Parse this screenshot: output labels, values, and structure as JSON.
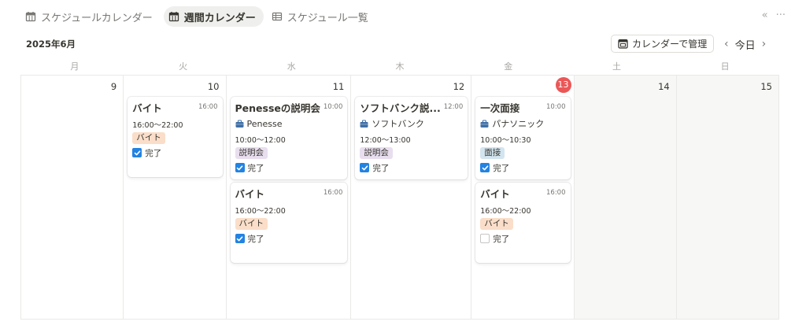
{
  "tabs": [
    {
      "label": "スケジュールカレンダー",
      "icon": "calendar-icon",
      "active": false
    },
    {
      "label": "週間カレンダー",
      "icon": "calendar-icon",
      "active": true
    },
    {
      "label": "スケジュール一覧",
      "icon": "table-icon",
      "active": false
    }
  ],
  "toolbar": {
    "collapse_icon": "«",
    "more_icon": "···",
    "month_label": "2025年6月",
    "manage_label": "カレンダーで管理",
    "today_label": "今日",
    "prev_icon": "‹",
    "next_icon": "›"
  },
  "weekdays": [
    "月",
    "火",
    "水",
    "木",
    "金",
    "土",
    "日"
  ],
  "colors": {
    "accent": "#2383e2",
    "today": "#eb5757",
    "tag_baito": "#fadec9",
    "tag_setsumeikai": "#e8deee",
    "tag_mensetsu": "#d3e5ef"
  },
  "days": [
    {
      "num": "9",
      "today": false,
      "weekend": false,
      "events": []
    },
    {
      "num": "10",
      "today": false,
      "weekend": false,
      "events": [
        {
          "title": "バイト",
          "time": "16:00",
          "company": "",
          "range": "16:00〜22:00",
          "tag": "バイト",
          "tag_color": "#fadec9",
          "done_label": "完了",
          "done": true
        }
      ]
    },
    {
      "num": "11",
      "today": false,
      "weekend": false,
      "events": [
        {
          "title": "Penesseの説明会",
          "time": "10:00",
          "company": "Penesse",
          "range": "10:00〜12:00",
          "tag": "説明会",
          "tag_color": "#e8deee",
          "done_label": "完了",
          "done": true
        },
        {
          "title": "バイト",
          "time": "16:00",
          "company": "",
          "range": "16:00〜22:00",
          "tag": "バイト",
          "tag_color": "#fadec9",
          "done_label": "完了",
          "done": true
        }
      ]
    },
    {
      "num": "12",
      "today": false,
      "weekend": false,
      "events": [
        {
          "title": "ソフトバンク説...",
          "time": "12:00",
          "company": "ソフトバンク",
          "range": "12:00〜13:00",
          "tag": "説明会",
          "tag_color": "#e8deee",
          "done_label": "完了",
          "done": true
        }
      ]
    },
    {
      "num": "13",
      "today": true,
      "weekend": false,
      "events": [
        {
          "title": "一次面接",
          "time": "10:00",
          "company": "パナソニック",
          "range": "10:00〜10:30",
          "tag": "面接",
          "tag_color": "#d3e5ef",
          "done_label": "完了",
          "done": true
        },
        {
          "title": "バイト",
          "time": "16:00",
          "company": "",
          "range": "16:00〜22:00",
          "tag": "バイト",
          "tag_color": "#fadec9",
          "done_label": "完了",
          "done": false
        }
      ]
    },
    {
      "num": "14",
      "today": false,
      "weekend": true,
      "events": []
    },
    {
      "num": "15",
      "today": false,
      "weekend": true,
      "events": []
    }
  ]
}
